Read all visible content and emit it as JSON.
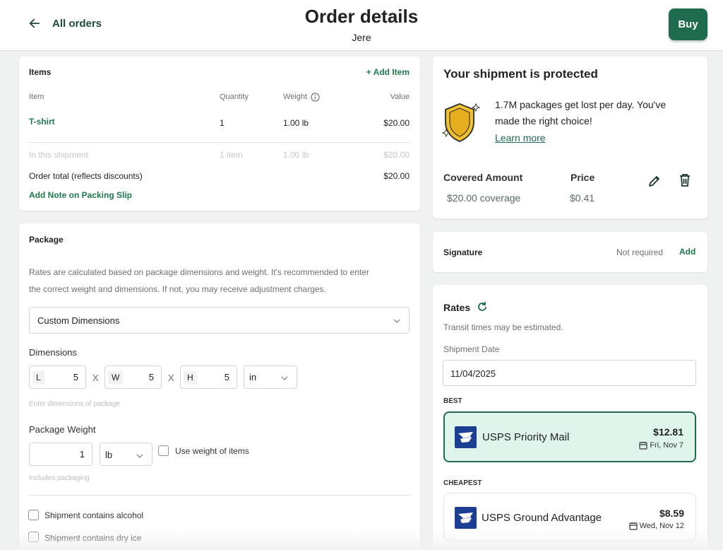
{
  "header": {
    "back_label": "All orders",
    "title": "Order details",
    "subtitle": "Jere",
    "buy_label": "Buy"
  },
  "items": {
    "heading": "Items",
    "add_item": "+ Add Item",
    "columns": {
      "item": "Item",
      "quantity": "Quantity",
      "weight": "Weight",
      "value": "Value"
    },
    "rows": [
      {
        "name": "T-shirt",
        "quantity": "1",
        "weight": "1.00 lb",
        "value": "$20.00"
      }
    ],
    "shipment": {
      "label": "In this shipment",
      "quantity": "1 item",
      "weight": "1.00 lb",
      "value": "$20.00"
    },
    "order_total": {
      "label": "Order total (reflects discounts)",
      "value": "$20.00"
    },
    "add_note": "Add Note on Packing Slip"
  },
  "package": {
    "heading": "Package",
    "description_line1": "Rates are calculated based on package dimensions and weight. It's recommended to enter",
    "description_line2": "the correct weight and dimensions. If not, you may receive adjustment charges.",
    "type_selected": "Custom Dimensions",
    "dimensions_label": "Dimensions",
    "dims": [
      {
        "prefix": "L",
        "value": "5"
      },
      {
        "prefix": "W",
        "value": "5"
      },
      {
        "prefix": "H",
        "value": "5"
      }
    ],
    "separator": "X",
    "unit_selected": "in",
    "dims_help": "Enter dimensions of package",
    "weight_label": "Package Weight",
    "weight_value": "1",
    "weight_unit": "lb",
    "use_weight_label": "Use weight of items",
    "weight_help": "Includes packaging",
    "alcohol_label": "Shipment contains alcohol",
    "dry_ice_label": "Shipment contains dry ice"
  },
  "protection": {
    "heading": "Your shipment is protected",
    "message_line1": "1.7M packages get lost per day. You've",
    "message_line2": "made the right choice!",
    "learn_more": "Learn more",
    "covered_label": "Covered Amount",
    "covered_value": "$20.00 coverage",
    "price_label": "Price",
    "price_value": "$0.41"
  },
  "signature": {
    "label": "Signature",
    "status": "Not required",
    "add": "Add"
  },
  "rates": {
    "heading": "Rates",
    "transit_note": "Transit times may be estimated.",
    "date_label": "Shipment Date",
    "date_value": "11/04/2025",
    "options": [
      {
        "tag": "BEST",
        "carrier": "USPS Priority Mail",
        "price": "$12.81",
        "eta": "Fri, Nov 7"
      },
      {
        "tag": "CHEAPEST",
        "carrier": "USPS Ground Advantage",
        "price": "$8.59",
        "eta": "Wed, Nov 12"
      }
    ]
  },
  "colors": {
    "brand_green": "#1f6b4d",
    "link_green": "#1e7a4d",
    "selected_rate_bg": "#dff4ea",
    "usps_blue": "#1c3f94",
    "shield_gold": "#f2c230"
  },
  "icons": [
    "arrow-left-icon",
    "info-icon",
    "chevron-down-icon",
    "shield-icon",
    "pencil-icon",
    "trash-icon",
    "refresh-icon",
    "calendar-icon",
    "usps-eagle-logo"
  ]
}
